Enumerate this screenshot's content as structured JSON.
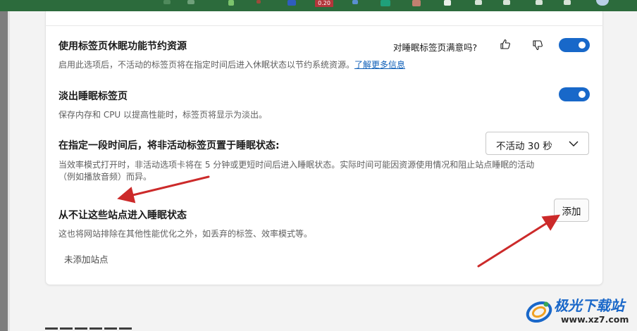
{
  "taskbar": {
    "badge": "0.20"
  },
  "sleeping_tabs": {
    "title": "使用标签页休眠功能节约资源",
    "description": "启用此选项后，不活动的标签页将在指定时间后进入休眠状态以节约系统资源。",
    "learn_more": "了解更多信息",
    "feedback_question": "对睡眠标签页满意吗?",
    "enabled": true
  },
  "fade_tabs": {
    "title": "淡出睡眠标签页",
    "description": "保存内存和 CPU 以提高性能时，标签页将显示为淡出。",
    "enabled": true
  },
  "sleep_timeout": {
    "title": "在指定一段时间后，将非活动标签页置于睡眠状态:",
    "description_line1": "当效率模式打开时，非活动选项卡将在 5 分钟或更短时间后进入睡眠状态。实际时间可能因资源使用情况和阻止站点睡眠的活动",
    "description_line2": "（例如播放音频）而异。",
    "selected": "不活动 30 秒"
  },
  "exclusions": {
    "title": "从不让这些站点进入睡眠状态",
    "description": "这也将网站排除在其他性能优化之外，如丢弃的标签、效率模式等。",
    "add_label": "添加",
    "empty_text": "未添加站点"
  },
  "watermark": {
    "title": "极光下载站",
    "url": "www.xz7.com"
  },
  "colors": {
    "toggle_on": "#1868c9",
    "link": "#0f5fb8",
    "arrow": "#cc2a2a",
    "taskbar": "#2c6b3c"
  }
}
